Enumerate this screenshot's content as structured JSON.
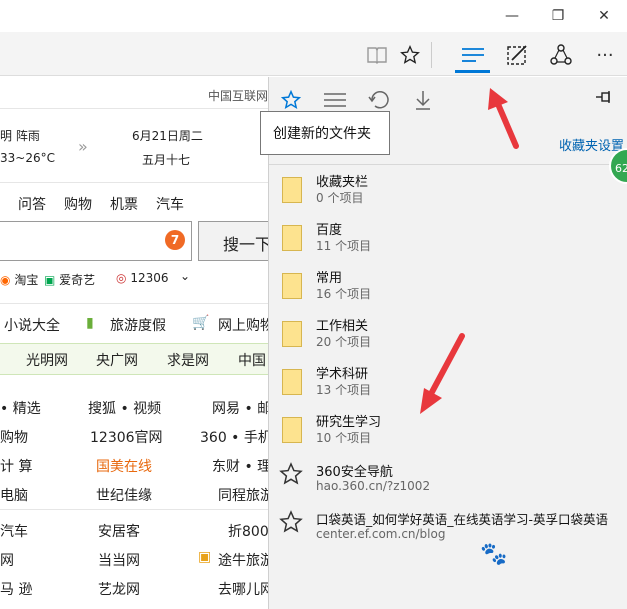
{
  "toolbar": {
    "reading_view_icon": "book-icon",
    "favorite_icon": "star-icon",
    "hub_icon": "hub-lines-icon",
    "notes_icon": "pen-note-icon",
    "share_icon": "share-icon",
    "more_icon": "ellipsis-icon"
  },
  "window": {
    "minimize": "—",
    "restore": "❐",
    "close": "✕"
  },
  "page": {
    "top_link": "中国互联网",
    "weather": {
      "condition": "明 阵雨",
      "temp": "33~26°C"
    },
    "date": {
      "solar": "6月21日周二",
      "lunar": "五月十七"
    },
    "nav": [
      "问答",
      "购物",
      "机票",
      "汽车"
    ],
    "search_badge": "7",
    "search_button": "搜一下",
    "quick_links": [
      "淘宝",
      "爱奇艺",
      "12306"
    ],
    "categories": [
      "小说大全",
      "旅游度假",
      "网上购物"
    ],
    "green_nav": [
      "光明网",
      "央广网",
      "求是网",
      "中国"
    ],
    "grid": [
      [
        "• 精选",
        "搜狐 • 视频",
        "网易 • 邮"
      ],
      [
        "购物",
        "12306官网",
        "360 • 手机"
      ],
      [
        "计 算",
        "国美在线",
        "东财 • 理"
      ],
      [
        "电脑",
        "世纪佳缘",
        "同程旅游"
      ],
      [
        "汽车",
        "安居客",
        "折800"
      ],
      [
        "网",
        "当当网",
        "途牛旅游"
      ],
      [
        "马 逊",
        "艺龙网",
        "去哪儿网"
      ]
    ]
  },
  "hub": {
    "tooltip": "创建新的文件夹",
    "settings_link": "收藏夹设置",
    "items": [
      {
        "type": "folder",
        "title": "收藏夹栏",
        "sub": "0 个项目"
      },
      {
        "type": "folder",
        "title": "百度",
        "sub": "11 个项目"
      },
      {
        "type": "folder",
        "title": "常用",
        "sub": "16 个项目"
      },
      {
        "type": "folder",
        "title": "工作相关",
        "sub": "20 个项目"
      },
      {
        "type": "folder",
        "title": "学术科研",
        "sub": "13 个项目"
      },
      {
        "type": "folder",
        "title": "研究生学习",
        "sub": "10 个项目"
      },
      {
        "type": "link",
        "title": "360安全导航",
        "sub": "hao.360.cn/?z1002"
      },
      {
        "type": "link",
        "title": "口袋英语_如何学好英语_在线英语学习-英孚口袋英语",
        "sub": "center.ef.com.cn/blog"
      }
    ]
  },
  "badge": "62",
  "colors": {
    "accent": "#0078d7",
    "arrow": "#e8383d",
    "folder": "#fde38f"
  }
}
